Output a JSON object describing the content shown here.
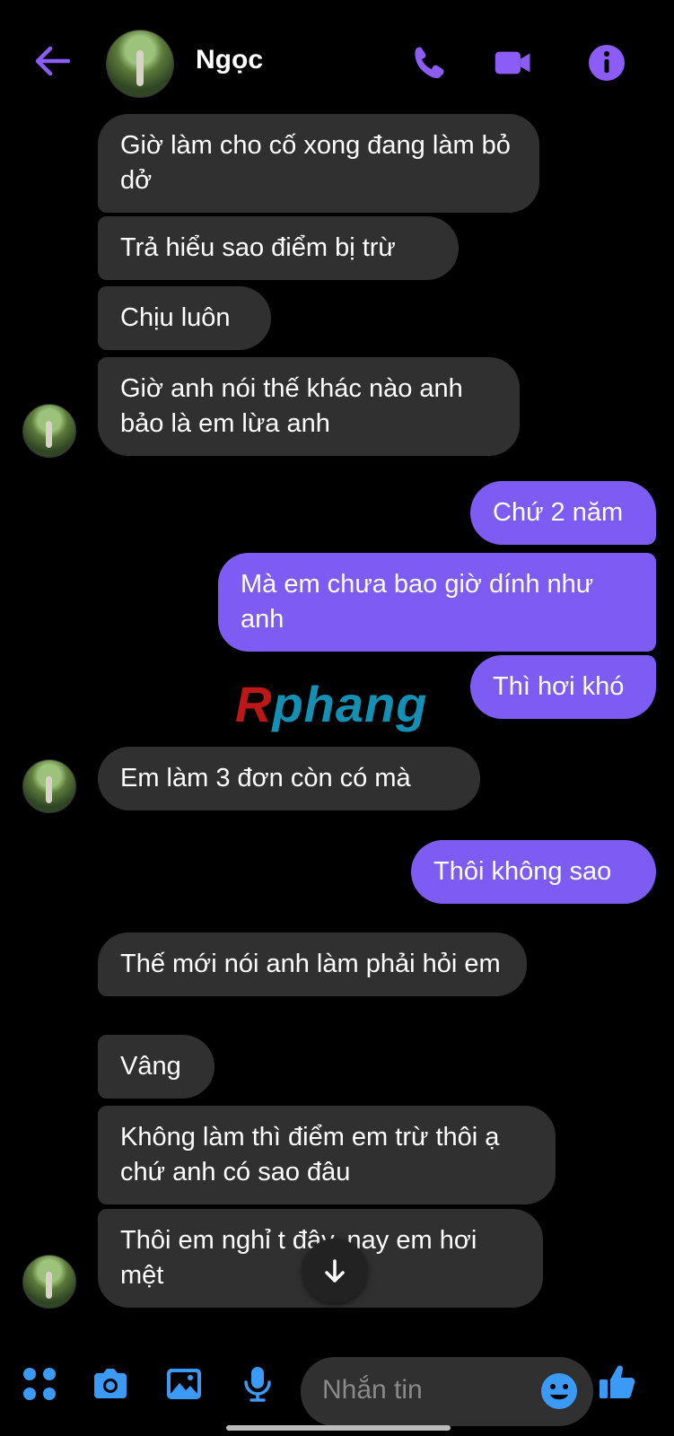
{
  "header": {
    "title": "Ngọc",
    "back_icon": "arrow-left-icon",
    "call_icon": "phone-icon",
    "video_icon": "video-camera-icon",
    "info_icon": "info-icon"
  },
  "messages": [
    {
      "side": "in",
      "text": "Giờ làm cho cố xong đang làm bỏ dở"
    },
    {
      "side": "in",
      "text": "Trả hiểu sao điểm bị trừ"
    },
    {
      "side": "in",
      "text": "Chịu luôn"
    },
    {
      "side": "in",
      "text": "Giờ anh nói thế khác nào anh bảo là em lừa anh"
    },
    {
      "side": "out",
      "text": "Chứ 2 năm"
    },
    {
      "side": "out",
      "text": "Mà em chưa bao giờ dính như anh"
    },
    {
      "side": "out",
      "text": "Thì hơi khó"
    },
    {
      "side": "in",
      "text": "Em làm 3 đơn còn có mà"
    },
    {
      "side": "out",
      "text": "Thôi không sao"
    },
    {
      "side": "in",
      "text": "Thế mới nói anh làm phải hỏi em"
    },
    {
      "side": "in",
      "text": "Vâng"
    },
    {
      "side": "in",
      "text": "Không làm thì điểm em trừ thôi ạ chứ anh có sao đâu"
    },
    {
      "side": "in",
      "text": "Thôi em nghỉ t đây, nay em hơi mệt"
    }
  ],
  "watermark": {
    "prefix": "R",
    "rest": "phang"
  },
  "composer": {
    "placeholder": "Nhắn tin"
  },
  "colors": {
    "accent": "#7c5cf2",
    "incoming_bubble": "#303030",
    "background": "#000000"
  }
}
